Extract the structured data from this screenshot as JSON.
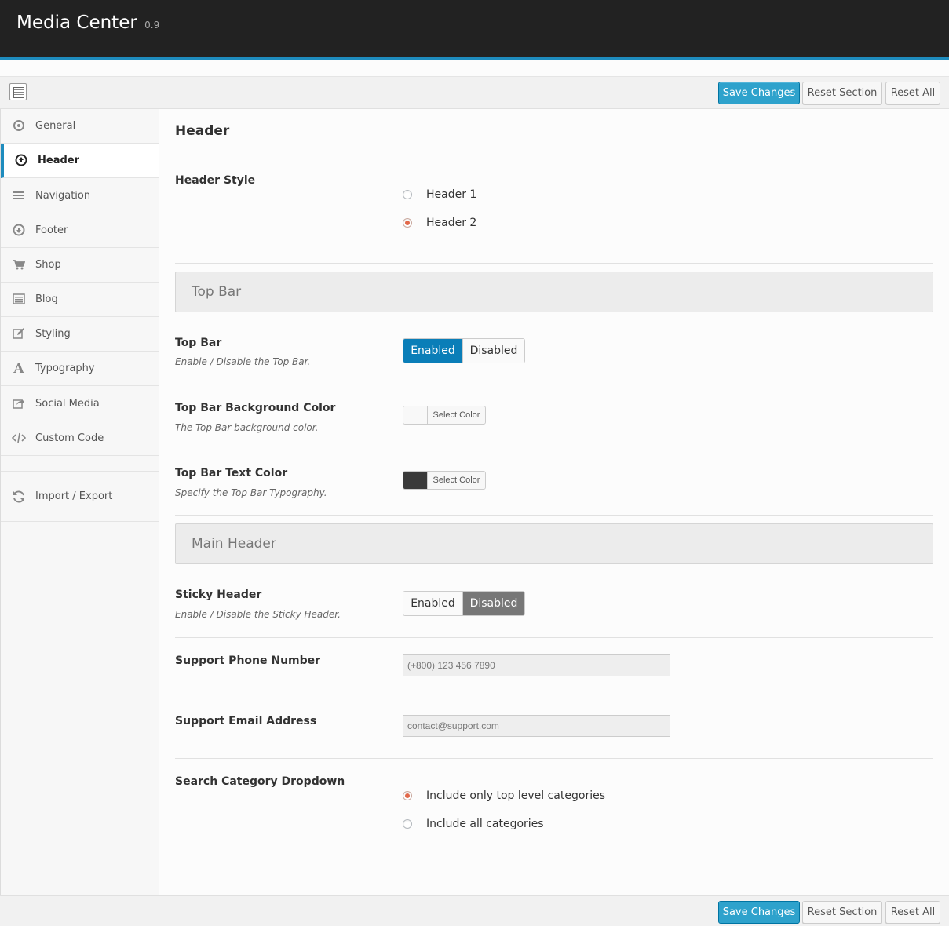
{
  "app": {
    "title": "Media Center",
    "version": "0.9"
  },
  "toolbar": {
    "save_label": "Save Changes",
    "reset_section_label": "Reset Section",
    "reset_all_label": "Reset All"
  },
  "sidebar": {
    "items": [
      {
        "label": "General",
        "icon": "circle-dot-icon"
      },
      {
        "label": "Header",
        "icon": "arrow-up-circle-icon",
        "active": true
      },
      {
        "label": "Navigation",
        "icon": "menu-lines-icon"
      },
      {
        "label": "Footer",
        "icon": "arrow-down-circle-icon"
      },
      {
        "label": "Shop",
        "icon": "cart-icon"
      },
      {
        "label": "Blog",
        "icon": "list-icon"
      },
      {
        "label": "Styling",
        "icon": "edit-icon"
      },
      {
        "label": "Typography",
        "icon": "font-icon"
      },
      {
        "label": "Social Media",
        "icon": "share-icon"
      },
      {
        "label": "Custom Code",
        "icon": "code-icon"
      },
      {
        "label": "Import / Export",
        "icon": "refresh-icon"
      }
    ]
  },
  "main": {
    "section_title": "Header",
    "header_style": {
      "label": "Header Style",
      "options": [
        "Header 1",
        "Header 2"
      ],
      "selected": "Header 2"
    },
    "top_bar_group": "Top Bar",
    "top_bar": {
      "label": "Top Bar",
      "desc": "Enable / Disable the Top Bar.",
      "on": "Enabled",
      "off": "Disabled",
      "value": "Enabled"
    },
    "top_bar_bg": {
      "label": "Top Bar Background Color",
      "desc": "The Top Bar background color.",
      "button": "Select Color",
      "color": "#f8f8f8"
    },
    "top_bar_text": {
      "label": "Top Bar Text Color",
      "desc": "Specify the Top Bar Typography.",
      "button": "Select Color",
      "color": "#3a3a3a"
    },
    "main_header_group": "Main Header",
    "sticky": {
      "label": "Sticky Header",
      "desc": "Enable / Disable the Sticky Header.",
      "on": "Enabled",
      "off": "Disabled",
      "value": "Disabled"
    },
    "phone": {
      "label": "Support Phone Number",
      "value": "(+800) 123 456 7890"
    },
    "email": {
      "label": "Support Email Address",
      "value": "contact@support.com"
    },
    "search_dropdown": {
      "label": "Search Category Dropdown",
      "options": [
        "Include only top level categories",
        "Include all categories"
      ],
      "selected": "Include only top level categories"
    }
  },
  "colors": {
    "accent": "#1e8cbe",
    "primary_button": "#2ea2cc",
    "radio_checked": "#e2684a",
    "toggle_on": "#0a7eb8"
  }
}
